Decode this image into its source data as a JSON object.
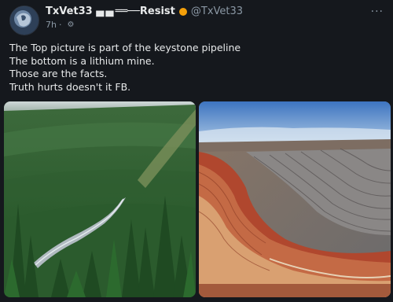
{
  "post": {
    "display_name": "TxVet33 ▄ ▄ ══──Resist",
    "handle": "@TxVet33",
    "time": "7h",
    "more_label": "···",
    "settings_icon": "gear-icon",
    "lines": [
      "The Top picture is part of the keystone pipeline",
      "The bottom is a lithium mine.",
      "Those are the facts.",
      "Truth hurts doesn't it FB."
    ]
  },
  "colors": {
    "background": "#15181d",
    "text_primary": "#e7e9ea",
    "text_secondary": "#8b98a5",
    "badge": "#f4a00a"
  },
  "media": {
    "images": [
      {
        "subject": "pipeline-through-forest"
      },
      {
        "subject": "open-pit-mine"
      }
    ]
  }
}
